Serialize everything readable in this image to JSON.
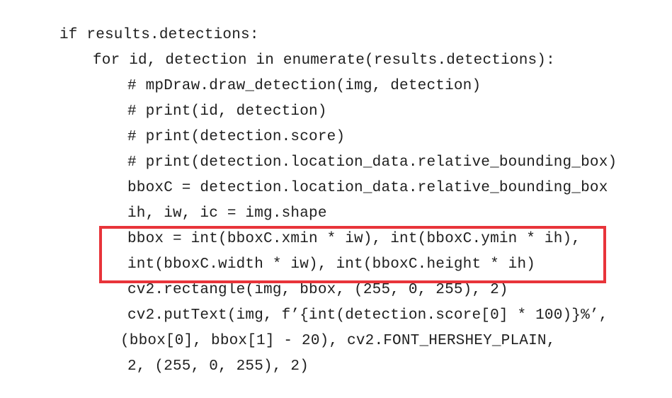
{
  "code": {
    "lines": [
      "if results.detections:",
      "for id, detection in enumerate(results.detections):",
      "# mpDraw.draw_detection(img, detection)",
      "# print(id, detection)",
      "# print(detection.score)",
      "# print(detection.location_data.relative_bounding_box)",
      "bboxC = detection.location_data.relative_bounding_box",
      "ih, iw, ic = img.shape",
      "bbox = int(bboxC.xmin * iw), int(bboxC.ymin * ih),",
      "int(bboxC.width * iw), int(bboxC.height * ih)",
      "cv2.rectangle(img, bbox, (255, 0, 255), 2)",
      "cv2.putText(img, f’{int(detection.score[0] * 100)}%’,",
      "(bbox[0], bbox[1] - 20), cv2.FONT_HERSHEY_PLAIN,",
      "2, (255, 0, 255), 2)"
    ]
  },
  "colors": {
    "text": "#1f1f1f",
    "highlight_border": "#e8343a",
    "background": "#ffffff"
  }
}
